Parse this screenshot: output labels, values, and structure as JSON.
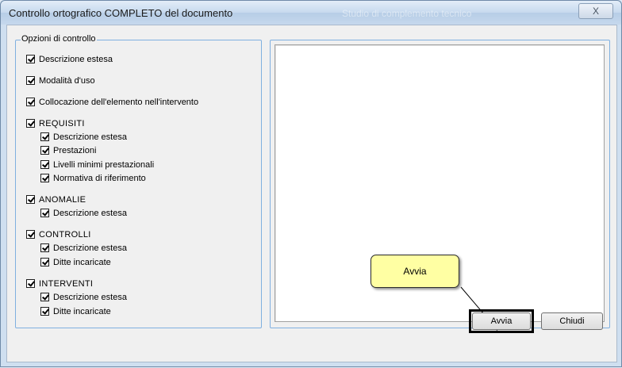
{
  "window": {
    "title": "Controllo ortografico COMPLETO del documento",
    "title_faded": "Studio di complemento tecnico",
    "close_label": "X"
  },
  "options_group": {
    "legend": "Opzioni di controllo",
    "items": [
      {
        "label": "Descrizione estesa",
        "checked": true,
        "level": 0
      },
      {
        "label": "Modalità d'uso",
        "checked": true,
        "level": 0
      },
      {
        "label": "Collocazione dell'elemento nell'intervento",
        "checked": true,
        "level": 0
      },
      {
        "label": "REQUISITI",
        "checked": true,
        "level": 0
      },
      {
        "label": "Descrizione estesa",
        "checked": true,
        "level": 1
      },
      {
        "label": "Prestazioni",
        "checked": true,
        "level": 1
      },
      {
        "label": "Livelli minimi prestazionali",
        "checked": true,
        "level": 1
      },
      {
        "label": "Normativa di riferimento",
        "checked": true,
        "level": 1
      },
      {
        "label": "ANOMALIE",
        "checked": true,
        "level": 0
      },
      {
        "label": "Descrizione estesa",
        "checked": true,
        "level": 1
      },
      {
        "label": "CONTROLLI",
        "checked": true,
        "level": 0
      },
      {
        "label": "Descrizione estesa",
        "checked": true,
        "level": 1
      },
      {
        "label": "Ditte incaricate",
        "checked": true,
        "level": 1
      },
      {
        "label": "INTERVENTI",
        "checked": true,
        "level": 0
      },
      {
        "label": "Descrizione estesa",
        "checked": true,
        "level": 1
      },
      {
        "label": "Ditte incaricate",
        "checked": true,
        "level": 1
      }
    ]
  },
  "callout": {
    "text": "Avvia"
  },
  "buttons": {
    "start": "Avvia",
    "close": "Chiudi"
  },
  "colors": {
    "callout_bg": "#ffffa3",
    "group_border": "#7fb0e0"
  }
}
